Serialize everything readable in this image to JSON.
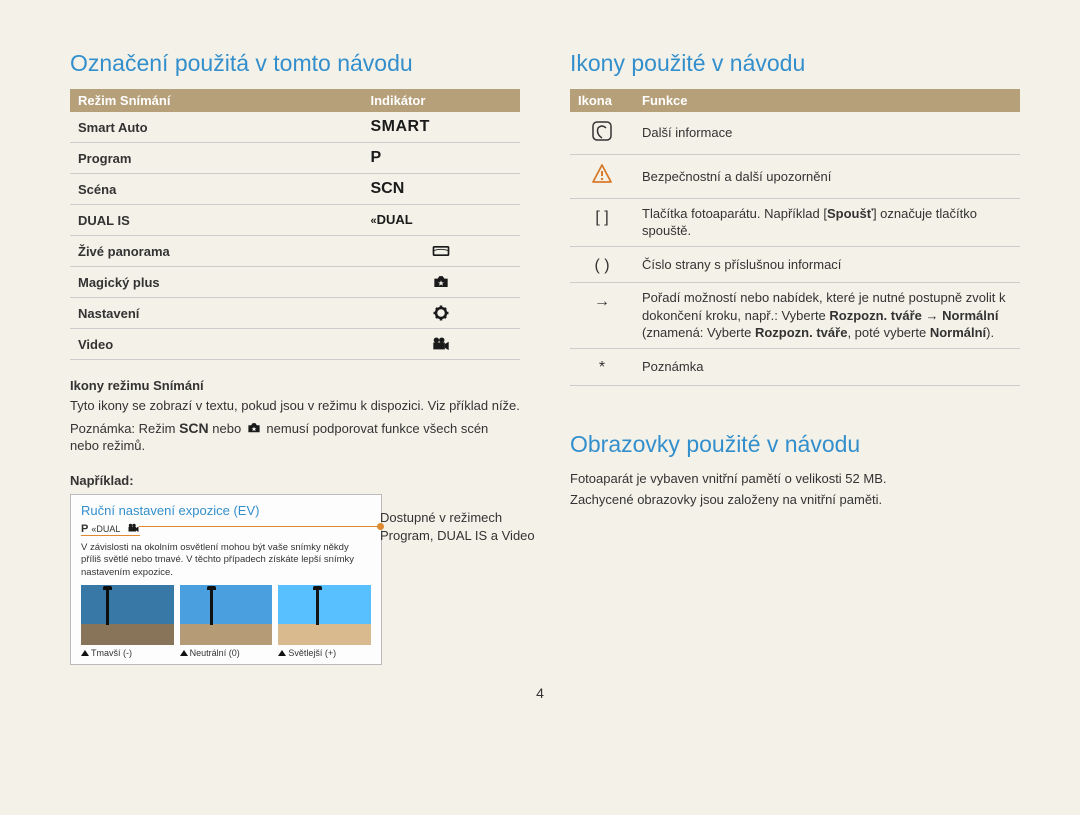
{
  "left": {
    "title": "Označení použitá v tomto návodu",
    "table_headers": {
      "mode": "Režim Snímání",
      "indicator": "Indikátor"
    },
    "modes": [
      {
        "label": "Smart Auto",
        "indicator": "SMART"
      },
      {
        "label": "Program",
        "indicator": "P"
      },
      {
        "label": "Scéna",
        "indicator": "SCN"
      },
      {
        "label": "DUAL IS",
        "indicator": "DUAL"
      },
      {
        "label": "Živé panorama",
        "indicator": "pano"
      },
      {
        "label": "Magický plus",
        "indicator": "magic"
      },
      {
        "label": "Nastavení",
        "indicator": "settings"
      },
      {
        "label": "Video",
        "indicator": "video"
      }
    ],
    "icons_mode_title": "Ikony režimu Snímání",
    "icons_mode_text": "Tyto ikony se zobrazí v textu, pokud jsou v režimu k dispozici. Viz příklad níže.",
    "note_prefix": "Poznámka: Režim ",
    "note_middle": " nebo ",
    "note_suffix": " nemusí podporovat funkce všech scén nebo režimů.",
    "example_label": "Například:",
    "example": {
      "title": "Ruční nastavení expozice (EV)",
      "desc": "V závislosti na okolním osvětlení mohou být vaše snímky někdy příliš světlé nebo tmavé. V těchto případech získáte lepší snímky nastavením expozice.",
      "captions": [
        "Tmavší (-)",
        "Neutrální (0)",
        "Světlejší (+)"
      ]
    },
    "callout": "Dostupné v režimech Program, DUAL IS a Video"
  },
  "right_icons": {
    "title": "Ikony použité v návodu",
    "headers": {
      "icon": "Ikona",
      "func": "Funkce"
    },
    "rows": [
      {
        "icon": "info",
        "text": "Další informace"
      },
      {
        "icon": "warn",
        "text": "Bezpečnostní a další upozornění"
      },
      {
        "icon": "[  ]",
        "text_html": "Tlačítka fotoaparátu. Například [<b>Spoušť</b>] označuje tlačítko spouště."
      },
      {
        "icon": "(  )",
        "text": "Číslo strany s příslušnou informací"
      },
      {
        "icon": "→",
        "text_html": "Pořadí možností nebo nabídek, které je nutné postupně zvolit k dokončení kroku, např.: Vyberte <b>Rozpozn. tváře</b> → <b>Normální</b> (znamená: Vyberte <b>Rozpozn. tváře</b>, poté vyberte <b>Normální</b>)."
      },
      {
        "icon": "*",
        "text": "Poznámka"
      }
    ]
  },
  "right_screens": {
    "title": "Obrazovky použité v návodu",
    "line1": "Fotoaparát je vybaven vnitřní pamětí o velikosti 52 MB.",
    "line2": "Zachycené obrazovky jsou založeny na vnitřní paměti."
  },
  "page_number": "4"
}
